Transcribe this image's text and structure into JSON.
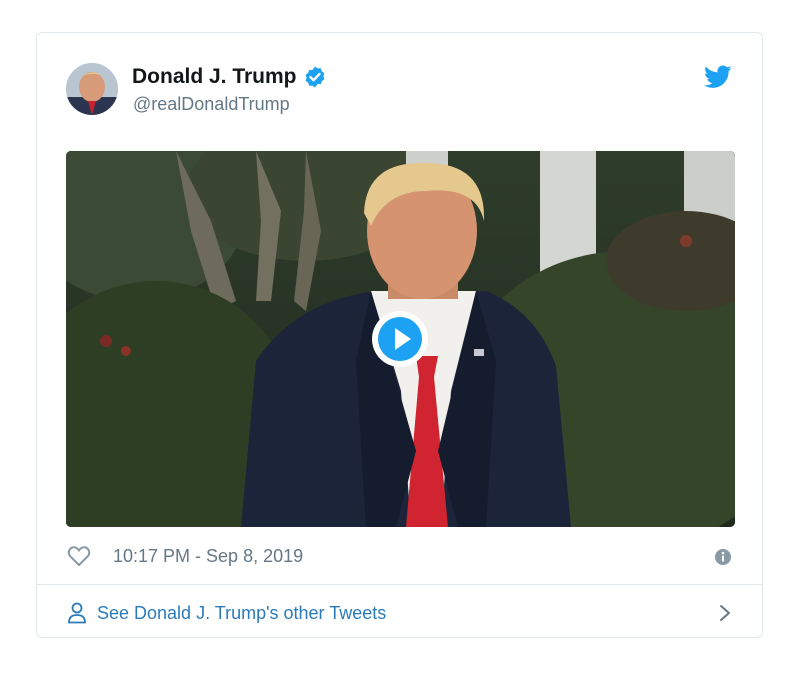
{
  "tweet": {
    "author_name": "Donald J. Trump",
    "author_handle": "@realDonaldTrump",
    "timestamp": "10:17 PM - Sep 8, 2019",
    "see_more_label": "See Donald J. Trump's other Tweets"
  },
  "icons": {
    "verified": "verified-badge-icon",
    "brand": "twitter-bird-icon",
    "play": "play-icon",
    "like": "heart-icon",
    "info": "info-icon",
    "profile": "person-icon",
    "more": "chevron-right-icon"
  },
  "colors": {
    "accent": "#1da1f2",
    "link": "#2b7bb9",
    "name": "#14171a",
    "secondary": "#657786",
    "border": "#e1e8ed"
  }
}
